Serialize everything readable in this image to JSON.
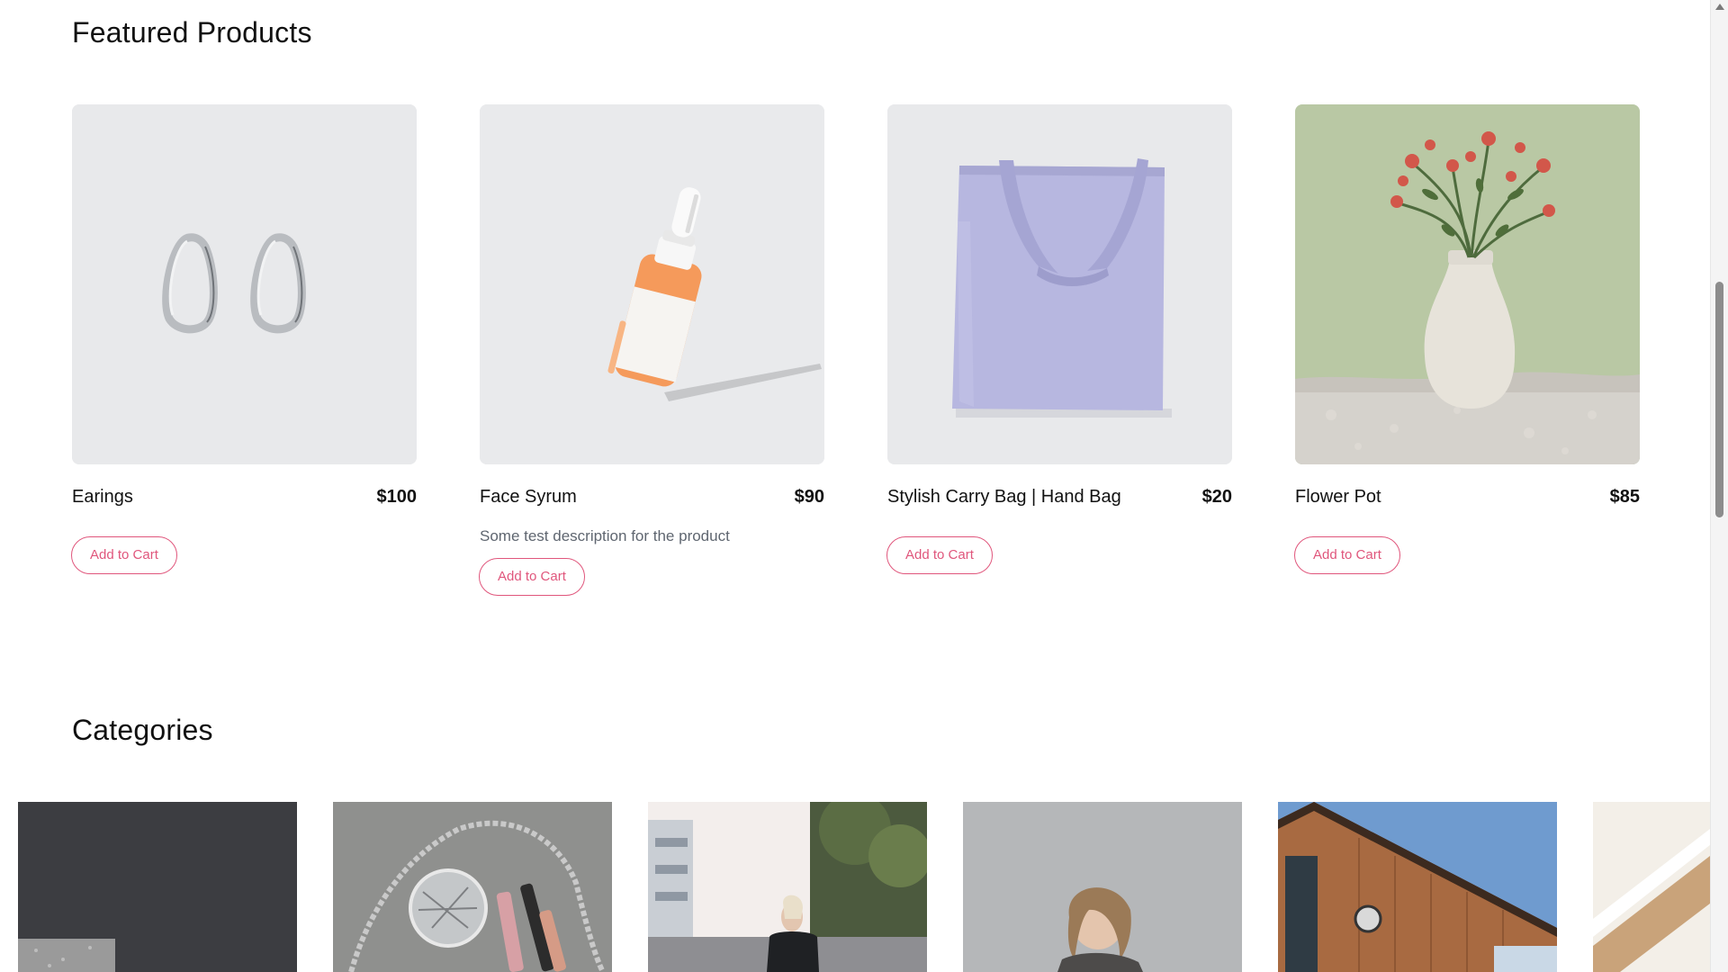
{
  "featured": {
    "title": "Featured Products",
    "products": [
      {
        "name": "Earings",
        "price": "$100",
        "description": "",
        "button": "Add to Cart",
        "image_icon": "earrings-image"
      },
      {
        "name": "Face Syrum",
        "price": "$90",
        "description": "Some test description for the product",
        "button": "Add to Cart",
        "image_icon": "serum-bottle-image"
      },
      {
        "name": "Stylish Carry Bag | Hand Bag",
        "price": "$20",
        "description": "",
        "button": "Add to Cart",
        "image_icon": "tote-bag-image"
      },
      {
        "name": "Flower Pot",
        "price": "$85",
        "description": "",
        "button": "Add to Cart",
        "image_icon": "flower-vase-image"
      }
    ]
  },
  "categories": {
    "title": "Categories"
  },
  "colors": {
    "accent": "#e0567c",
    "card_bg": "#e8e9eb",
    "muted_text": "#5f6670"
  }
}
